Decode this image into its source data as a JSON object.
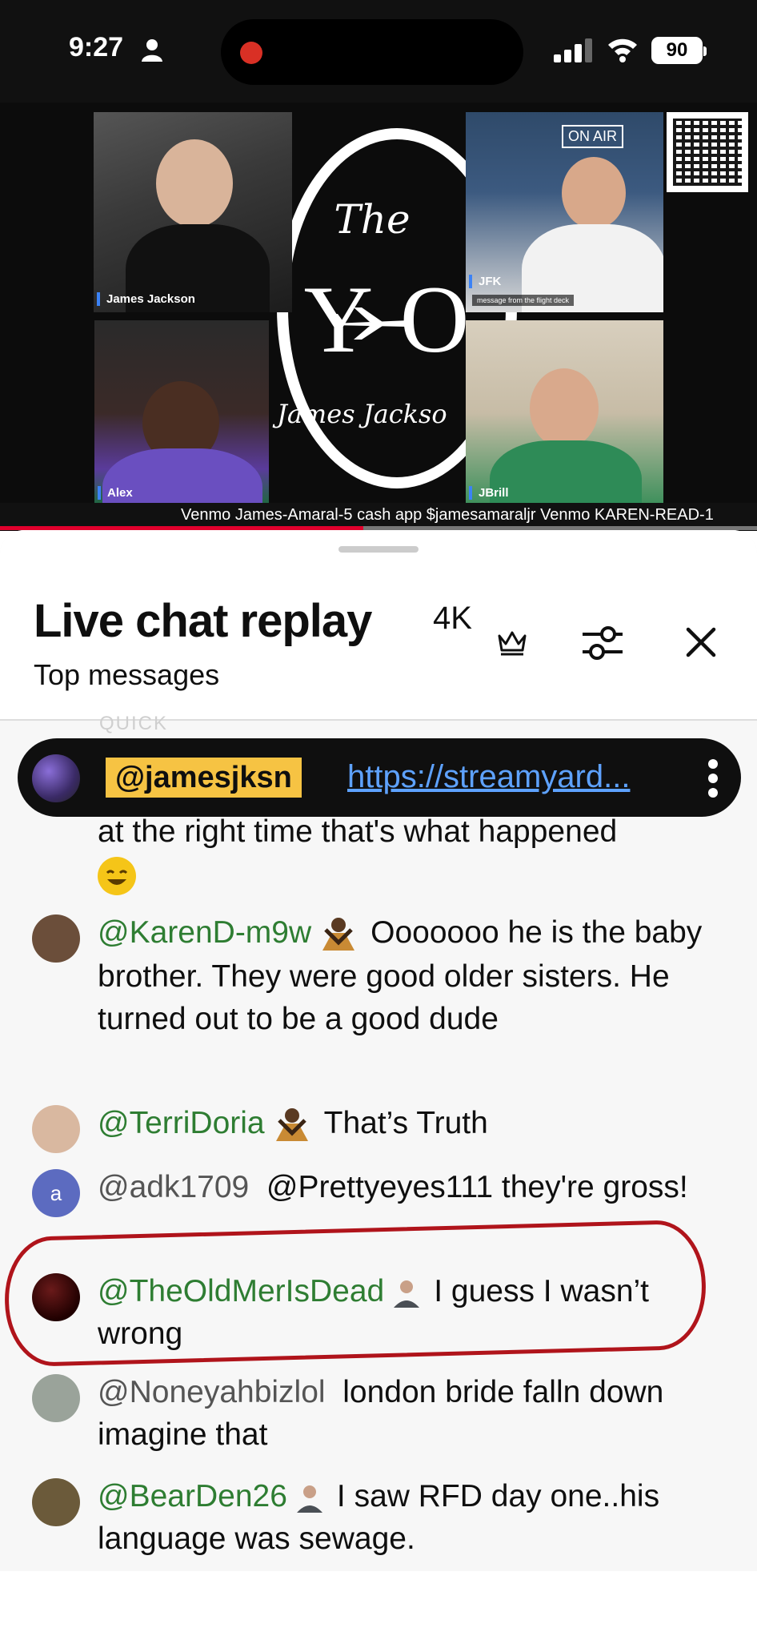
{
  "status_bar": {
    "time": "9:27",
    "battery": "90"
  },
  "video": {
    "tiles": [
      {
        "label": "James Jackson",
        "sub": ""
      },
      {
        "label": "JFK",
        "sub": "message from the flight deck"
      },
      {
        "label": "Alex",
        "sub": ""
      },
      {
        "label": "JBrill",
        "sub": ""
      }
    ],
    "jfk_sign": "ON AIR",
    "logo": {
      "the": "The",
      "yo": "Y O",
      "subtitle": "James Jackso"
    },
    "ticker": "Venmo James-Amaral-5 cash app $jamesamaraljr Venmo KAREN-READ-1",
    "progress": 0.48
  },
  "chat": {
    "title": "Live chat replay",
    "count": "4K",
    "subtitle": "Top messages",
    "pinned": {
      "handle": "@jamesjksn",
      "link": "https://streamyard..."
    },
    "faded_above": "QUICK",
    "messages": [
      {
        "author": "",
        "text": "at the right time that's what happened",
        "emoji": "rofl-emoji"
      },
      {
        "author": "@KarenD-m9w",
        "text": "Ooooooo he is the baby brother. They were good older sisters. He turned out to be a good dude",
        "avatar_color": "#6b4e3a"
      },
      {
        "author": "@TerriDoria",
        "text": "That’s Truth",
        "avatar_color": "#d9b8a0"
      },
      {
        "author": "@adk1709",
        "text": "@Prettyeyes111 they're gross!",
        "avatar_letter": "a",
        "avatar_color": "#5c6bc0"
      },
      {
        "author": "@TheOldMerIsDead",
        "text": "I guess I wasn’t wrong",
        "avatar_color": "#3a0a0a"
      },
      {
        "author": "@Noneyahbizlol",
        "text": "london bride falln down imagine that",
        "avatar_color": "#9aa39a"
      },
      {
        "author": "@BearDen26",
        "text": "I saw RFD day one..his language was sewage.",
        "avatar_color": "#6b5a3a"
      }
    ]
  }
}
